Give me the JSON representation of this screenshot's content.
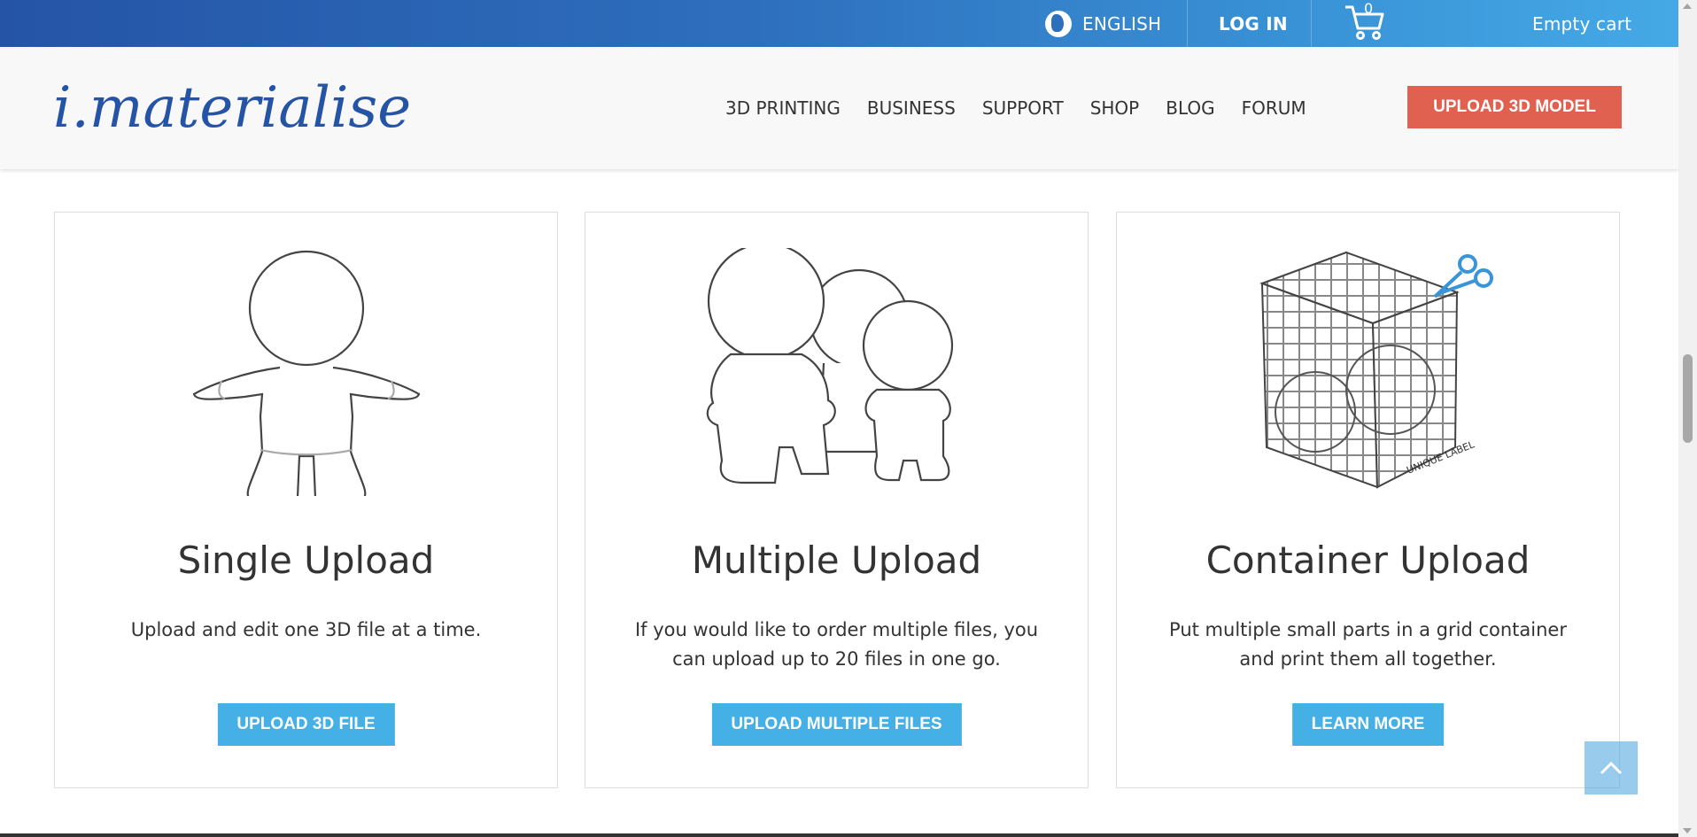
{
  "topbar": {
    "language": "ENGLISH",
    "login": "LOG IN",
    "cart_count": "0",
    "cart_status": "Empty cart"
  },
  "header": {
    "logo_text": "i.materialise",
    "nav": [
      "3D PRINTING",
      "BUSINESS",
      "SUPPORT",
      "SHOP",
      "BLOG",
      "FORUM"
    ],
    "upload_button": "UPLOAD 3D MODEL"
  },
  "cards": [
    {
      "title": "Single Upload",
      "description": "Upload and edit one 3D file at a time.",
      "button": "UPLOAD 3D FILE"
    },
    {
      "title": "Multiple Upload",
      "description": "If you would like to order multiple files, you can upload up to 20 files in one go.",
      "button": "UPLOAD MULTIPLE FILES"
    },
    {
      "title": "Container Upload",
      "description": "Put multiple small parts in a grid container and print them all together.",
      "button": "LEARN MORE",
      "illustration_label": "UNIQUE LABEL"
    }
  ],
  "colors": {
    "accent_blue": "#45b0e6",
    "accent_red": "#e0614f",
    "logo_blue": "#2554a6"
  },
  "icons": [
    "globe-icon",
    "cart-icon",
    "scissors-icon",
    "chevron-up-icon"
  ]
}
